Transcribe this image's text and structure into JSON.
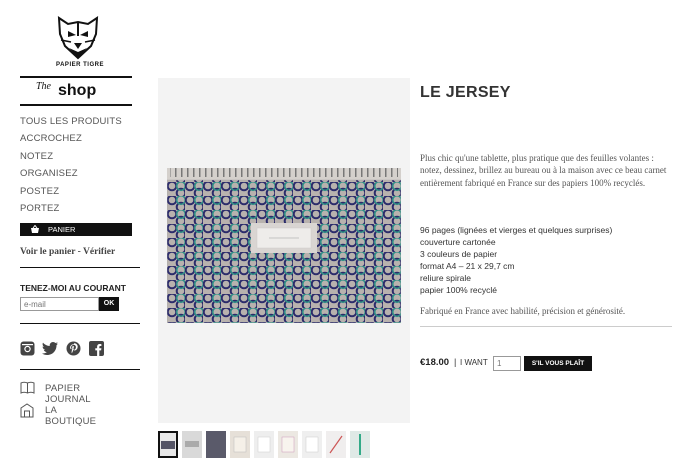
{
  "brand": {
    "name": "PAPIER TIGRE",
    "shop_prefix": "The",
    "shop_word": "shop"
  },
  "nav": {
    "items": [
      "TOUS LES PRODUITS",
      "ACCROCHEZ",
      "NOTEZ",
      "ORGANISEZ",
      "POSTEZ",
      "PORTEZ"
    ]
  },
  "cart": {
    "button_label": "PANIER",
    "icon": "basket-icon",
    "links": "Voir le panier - Vérifier"
  },
  "newsletter": {
    "label": "TENEZ-MOI AU COURANT",
    "placeholder": "e-mail",
    "submit": "OK"
  },
  "socials": [
    "instagram-icon",
    "twitter-icon",
    "pinterest-icon",
    "facebook-icon"
  ],
  "footer_links": [
    {
      "label": "PAPIER JOURNAL",
      "icon": "book-icon"
    },
    {
      "label": "LA BOUTIQUE",
      "icon": "shop-icon"
    }
  ],
  "product": {
    "title": "LE JERSEY",
    "description": "Plus chic qu'une tablette, plus pratique que des feuilles volantes : notez, dessinez, brillez au bureau ou à la maison avec ce beau carnet entièrement fabriqué en France sur des papiers 100% recyclés.",
    "specs": [
      "96 pages (lignées et vierges et quelques surprises)",
      "couverture cartonée",
      "3 couleurs de papier",
      "format A4 – 21 x 29,7 cm",
      "reliure spirale",
      "papier 100% recyclé"
    ],
    "made_in": "Fabriqué en France avec habilité, précision et générosité.",
    "price": "€18.00",
    "want_label": "I WANT",
    "quantity": "1",
    "buy_label": "S'IL VOUS PLAÎT"
  },
  "colors": {
    "accent": "#111111",
    "pattern_navy": "#2b2b6b",
    "pattern_teal": "#2f8f86",
    "cover_gray": "#b8b2ae"
  },
  "thumbnails_count": 9
}
